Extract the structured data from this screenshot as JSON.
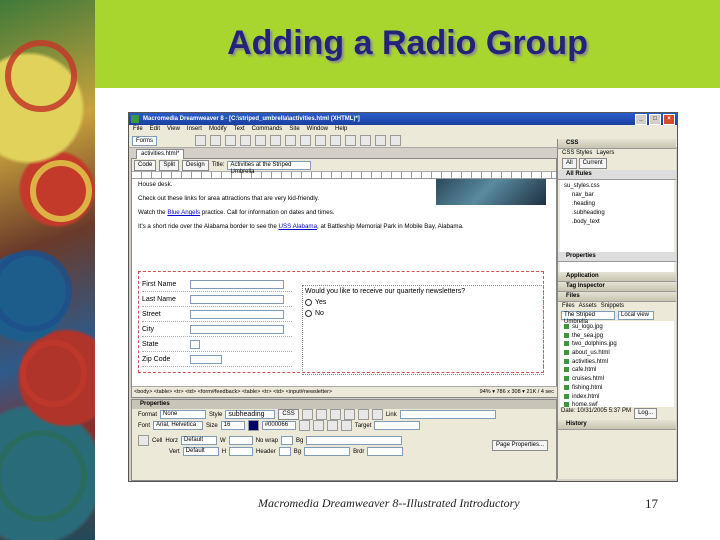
{
  "slide": {
    "title": "Adding a Radio Group",
    "footer": "Macromedia Dreamweaver 8--Illustrated Introductory",
    "page_number": "17"
  },
  "app": {
    "window_title": "Macromedia Dreamweaver 8 - [C:\\striped_umbrella\\activities.html (XHTML)*]",
    "menu": [
      "File",
      "Edit",
      "View",
      "Insert",
      "Modify",
      "Text",
      "Commands",
      "Site",
      "Window",
      "Help"
    ],
    "insert_category": "Forms",
    "doc_tab": "activities.html*",
    "view_buttons": [
      "Code",
      "Split",
      "Design"
    ],
    "title_label": "Title:",
    "page_title": "Activities at the Striped Umbrella"
  },
  "document": {
    "line1": "House desk.",
    "line2": "Check out these links for area attractions that are very kid-friendly.",
    "line3_pre": "Watch the ",
    "line3_link": "Blue Angels",
    "line3_post": " practice. Call for information on dates and times.",
    "line4_pre": "It's a short ride over the Alabama border to see the ",
    "line4_link": "USS Alabama",
    "line4_post": ", at Battleship Memorial Park in Mobile Bay, Alabama.",
    "form_labels": [
      "First Name",
      "Last Name",
      "Street",
      "City",
      "State",
      "Zip Code"
    ],
    "question": "Would you like to receive our quarterly newsletters?",
    "radio_yes": "Yes",
    "radio_no": "No",
    "status_path": "<body> <table> <tr> <td> <form#feedback> <table> <tr> <td> <input#newsletter>",
    "status_right": "94% ▾  786 x 308 ▾  21K / 4 sec"
  },
  "properties": {
    "header": "Properties",
    "format_label": "Format",
    "format_value": "None",
    "style_label": "Style",
    "style_value": "subheading",
    "css_button": "CSS",
    "font_label": "Font",
    "font_value": "Arial, Helvetica",
    "size_label": "Size",
    "size_value": "16",
    "color_value": "#000066",
    "link_label": "Link",
    "target_label": "Target",
    "cell_label": "Cell",
    "horz_label": "Horz",
    "horz_value": "Default",
    "vert_label": "Vert",
    "vert_value": "Default",
    "w_label": "W",
    "h_label": "H",
    "nowrap_label": "No wrap",
    "header_label": "Header",
    "bg_label": "Bg",
    "brdr_label": "Brdr",
    "page_props_button": "Page Properties..."
  },
  "panels": {
    "css_tab": "CSS",
    "css_styles_tab": "CSS Styles",
    "layers_tab": "Layers",
    "all_button": "All",
    "current_button": "Current",
    "all_rules_label": "All Rules",
    "stylesheet": "su_styles.css",
    "rules": [
      "nav_bar",
      ".heading",
      ".subheading",
      ".body_text"
    ],
    "properties_label": "Properties",
    "application_label": "Application",
    "tag_inspector_label": "Tag Inspector",
    "files_label": "Files",
    "files_tabs": [
      "Files",
      "Assets",
      "Snippets"
    ],
    "site_name": "The Striped Umbrella",
    "view_mode": "Local view",
    "files": [
      "su_logo.jpg",
      "the_sea.jpg",
      "two_dolphins.jpg",
      "about_us.html",
      "activities.html",
      "cafe.html",
      "cruises.html",
      "fishing.html",
      "index.html",
      "home.swf"
    ],
    "files_status": "Date: 10/31/2005 5:37 PM",
    "log_button": "Log...",
    "history_label": "History"
  }
}
